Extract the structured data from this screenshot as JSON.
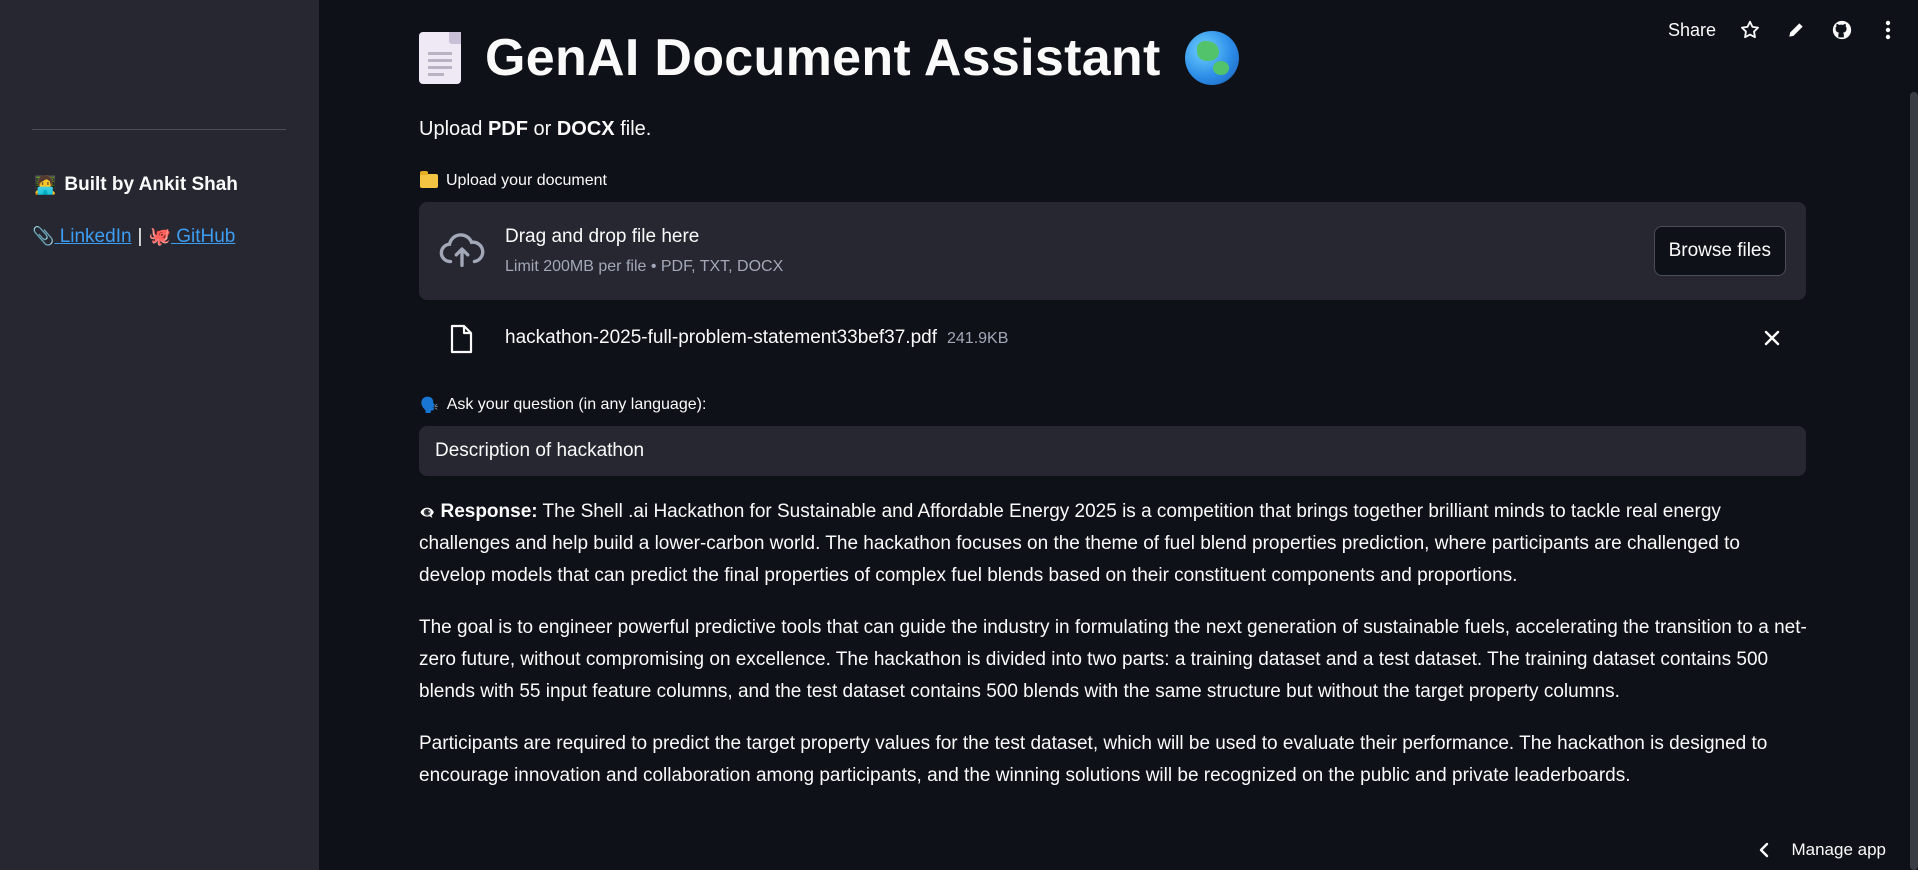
{
  "sidebar": {
    "built_by": "Built by Ankit Shah",
    "links": {
      "linkedin": "LinkedIn",
      "separator": "|",
      "github": "GitHub"
    }
  },
  "toolbar": {
    "share": "Share",
    "manage_app": "Manage app"
  },
  "header": {
    "title": "GenAI Document Assistant"
  },
  "upload": {
    "instruction_prefix": "Upload ",
    "format1": "PDF",
    "instruction_or": " or ",
    "format2": "DOCX",
    "instruction_suffix": " file.",
    "label": "Upload your document",
    "dropzone_title": "Drag and drop file here",
    "dropzone_limit": "Limit 200MB per file • PDF, TXT, DOCX",
    "browse_label": "Browse files",
    "file": {
      "name": "hackathon-2025-full-problem-statement33bef37.pdf",
      "size": "241.9KB"
    }
  },
  "question": {
    "label": "Ask your question (in any language):",
    "value": "Description of hackathon"
  },
  "response": {
    "label": "Response:",
    "paragraphs": [
      "The Shell .ai Hackathon for Sustainable and Affordable Energy 2025 is a competition that brings together brilliant minds to tackle real energy challenges and help build a lower-carbon world. The hackathon focuses on the theme of fuel blend properties prediction, where participants are challenged to develop models that can predict the final properties of complex fuel blends based on their constituent components and proportions.",
      "The goal is to engineer powerful predictive tools that can guide the industry in formulating the next generation of sustainable fuels, accelerating the transition to a net-zero future, without compromising on excellence. The hackathon is divided into two parts: a training dataset and a test dataset. The training dataset contains 500 blends with 55 input feature columns, and the test dataset contains 500 blends with the same structure but without the target property columns.",
      "Participants are required to predict the target property values for the test dataset, which will be used to evaluate their performance. The hackathon is designed to encourage innovation and collaboration among participants, and the winning solutions will be recognized on the public and private leaderboards."
    ]
  },
  "icons": {
    "builder": "technologist-emoji",
    "linkedin": "paperclip-emoji",
    "github": "octocat-emoji",
    "question": "speaking-head-emoji",
    "response": "eye-emoji"
  },
  "colors": {
    "background": "#0e1117",
    "sidebar": "#262730",
    "link": "#3d9df3",
    "muted_text": "#a3a8b8"
  }
}
